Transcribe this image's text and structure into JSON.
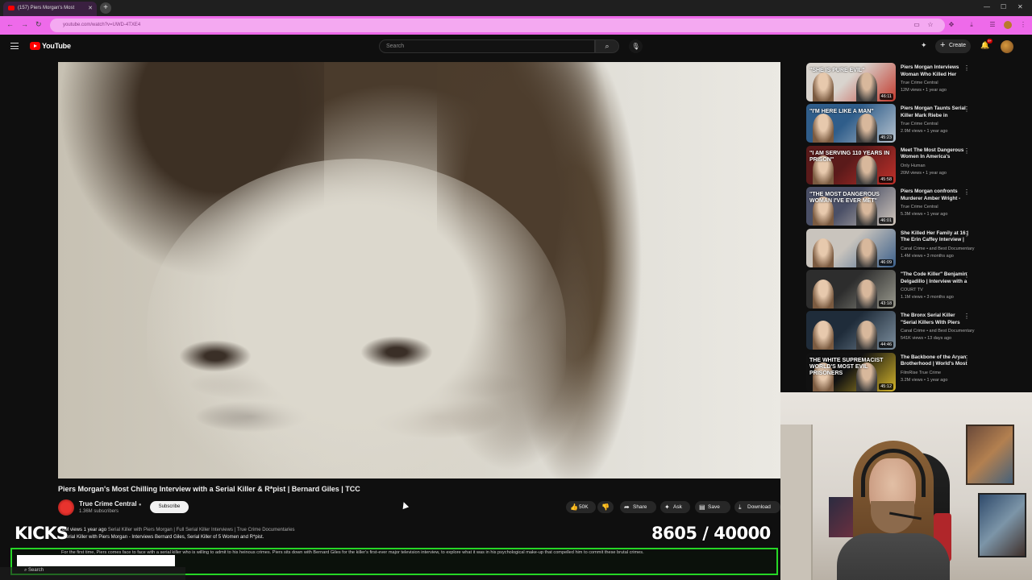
{
  "browser": {
    "tab_title": "(157) Piers Morgan's Most",
    "address": "youtube.com/watch?v=UWD-4TXE4",
    "new_tab": "+"
  },
  "header": {
    "logo_text": "YouTube",
    "search_placeholder": "Search",
    "create_label": "Create",
    "notification_count": "9+"
  },
  "video": {
    "title": "Piers Morgan's Most Chilling Interview with a Serial Killer & R*pist | Bernard Giles | TCC",
    "channel": "True Crime Central",
    "subscribers": "1.36M subscribers",
    "subscribe_label": "Subscribe",
    "likes": "50K",
    "share_label": "Share",
    "ask_label": "Ask",
    "save_label": "Save",
    "download_label": "Download",
    "desc_stats": "1.6M views  1 year ago",
    "desc_tags": "Serial Killer with Piers Morgan | Full Serial Killer Interviews | True Crime Documentaries",
    "desc_line2": "Serial Killer with Piers Morgan - Interviews Bernard Giles, Serial Killer of 5 Women and R*pist."
  },
  "overlay": {
    "kicks_label": "KICKS",
    "counter": "8605  / 40000",
    "ticker": "For the first time, Piers comes face to face with a serial killer who is willing to admit to his heinous crimes. Piers sits down with Bernard Giles for the killer's first-ever major television interview, to explore what it was in his psychological make-up that compelled him to commit these brutal crimes.",
    "taskbar_search": "Search"
  },
  "recommendations": [
    {
      "title": "Piers Morgan Interviews Woman Who Killed Her Entire ...",
      "channel": "True Crime Central",
      "meta": "12M views • 1 year ago",
      "duration": "46:11",
      "thumb_text": "\"SHE IS PURE EVIL\"",
      "thumb_colors": [
        "#d9d4ce",
        "#c23a2e"
      ]
    },
    {
      "title": "Piers Morgan Taunts Serial Killer Mark Riebe in Dangerous...",
      "channel": "True Crime Central",
      "meta": "2.9M views • 1 year ago",
      "duration": "45:23",
      "thumb_text": "\"I'M HERE LIKE A MAN\"",
      "thumb_colors": [
        "#2f5d8a",
        "#b8c4cf"
      ]
    },
    {
      "title": "Meet The Most Dangerous Women In America's Prisons | ...",
      "channel": "Only Human",
      "meta": "20M views • 1 year ago",
      "duration": "45:58",
      "thumb_text": "\"I AM SERVING 110 YEARS IN PRISON\"",
      "thumb_colors": [
        "#5a1a1a",
        "#c0302a"
      ]
    },
    {
      "title": "Piers Morgan confronts Murderer Amber Wright - Who ...",
      "channel": "True Crime Central",
      "meta": "5.3M views • 1 year ago",
      "duration": "46:01",
      "thumb_text": "\"THE MOST DANGEROUS WOMAN I'VE EVER MET\"",
      "thumb_colors": [
        "#4a4f66",
        "#d2c8bd"
      ]
    },
    {
      "title": "She Killed Her Family at 16 | The Erin Caffey Interview | Pie...",
      "channel": "Canal Crime • and Best Documentary",
      "meta": "1.4M views • 3 months ago",
      "duration": "46:09",
      "thumb_text": "",
      "thumb_colors": [
        "#c9c4bd",
        "#3b5f8a"
      ]
    },
    {
      "title": "\"The Code Killer\" Benjamin Delgadillo | Interview with a ...",
      "channel": "COURT TV",
      "meta": "1.1M views • 3 months ago",
      "duration": "43:18",
      "thumb_text": "",
      "thumb_colors": [
        "#2d2d2d",
        "#9a9a8e"
      ]
    },
    {
      "title": "The Bronx Serial Killer \"Serial Killers With Piers Morgan\" - ...",
      "channel": "Canal Crime • and Best Documentary",
      "meta": "541K views • 13 days ago",
      "duration": "44:46",
      "thumb_text": "",
      "thumb_colors": [
        "#1f2c3a",
        "#7d8f9e"
      ]
    },
    {
      "title": "The Backbone of the Aryan Brotherhood | World's Most Evi...",
      "channel": "FilmRise True Crime",
      "meta": "3.2M views • 1 year ago",
      "duration": "45:12",
      "thumb_text": "THE WHITE SUPREMACIST WORLD'S MOST EVIL PRISONERS",
      "thumb_colors": [
        "#111111",
        "#d4b52b"
      ]
    }
  ]
}
